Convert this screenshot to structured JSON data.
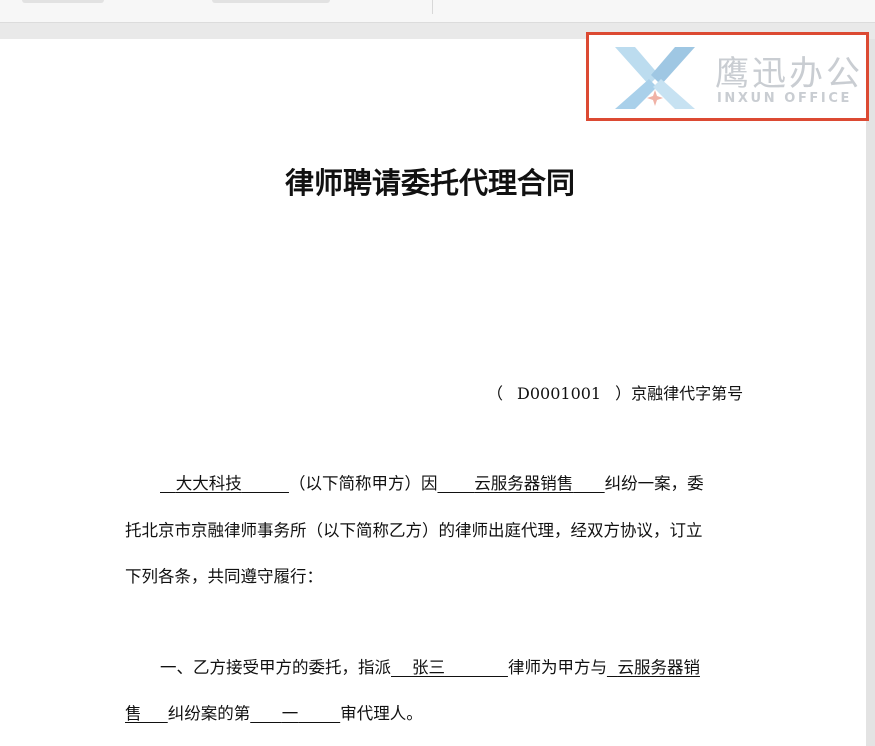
{
  "watermark": {
    "brand_cn": "鹰迅办公",
    "brand_en": "INXUN OFFICE",
    "logo_icon": "yingxun-x-icon",
    "highlight_color": "#dc4a33"
  },
  "document": {
    "title": "律师聘请委托代理合同",
    "reference": {
      "open": "（",
      "code": "D0001001",
      "close": "）",
      "suffix": "京融律代字第号"
    },
    "para1": {
      "party_a": "大大科技",
      "text1": "（以下简称甲方）因",
      "case_subject": "云服务器销售",
      "text2": "纠纷一案，委",
      "line2": "托北京市京融律师事务所（以下简称乙方）的律师出庭代理，经双方协议，订立",
      "line3": "下列各条，共同遵守履行："
    },
    "para2": {
      "prefix": "一、乙方接受甲方的委托，指派",
      "lawyer": "张三",
      "text1": "律师为甲方与",
      "case_part1": "云服务器销",
      "case_part2": "售",
      "text2": "纠纷案的第",
      "instance": "一",
      "text3": "审代理人。"
    }
  }
}
